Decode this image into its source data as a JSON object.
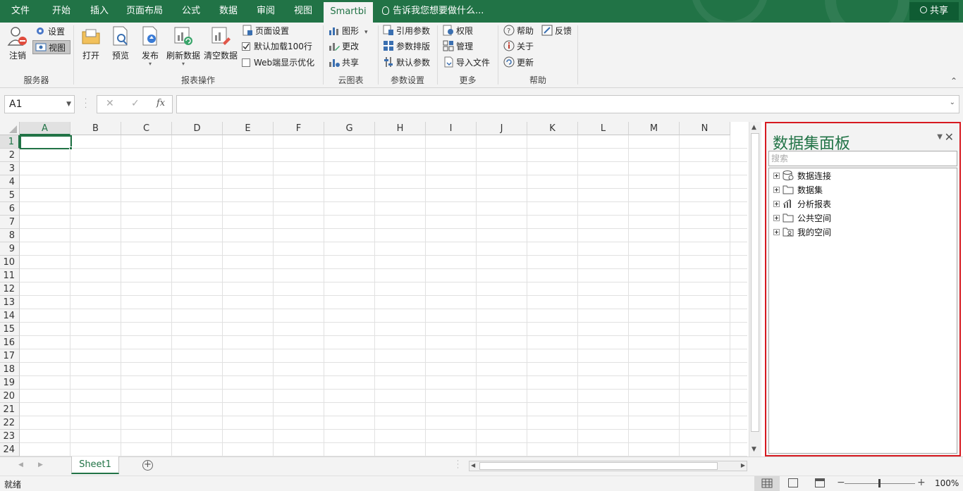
{
  "menu": {
    "tabs": [
      "文件",
      "开始",
      "插入",
      "页面布局",
      "公式",
      "数据",
      "审阅",
      "视图",
      "Smartbi"
    ],
    "tell_me": "告诉我您想要做什么...",
    "share": "共享"
  },
  "ribbon": {
    "server": {
      "logout": "注销",
      "settings": "设置",
      "view": "视图",
      "group_label": "服务器"
    },
    "report_ops": {
      "open": "打开",
      "preview": "预览",
      "publish": "发布",
      "refresh": "刷新数据",
      "clear": "清空数据",
      "page_setup": "页面设置",
      "load_default": "默认加载100行",
      "web_optimize": "Web端显示优化",
      "group_label": "报表操作"
    },
    "cloud_chart": {
      "chart": "图形",
      "change": "更改",
      "share": "共享",
      "group_label": "云图表"
    },
    "params": {
      "ref_param": "引用参数",
      "param_layout": "参数排版",
      "default_param": "默认参数",
      "group_label": "参数设置"
    },
    "more": {
      "permission": "权限",
      "manage": "管理",
      "import_file": "导入文件",
      "group_label": "更多"
    },
    "help": {
      "help": "帮助",
      "feedback": "反馈",
      "about": "关于",
      "update": "更新",
      "group_label": "帮助"
    }
  },
  "formula_bar": {
    "name_box": "A1",
    "fx": "fx",
    "cancel": "✕",
    "enter": "✓"
  },
  "grid": {
    "columns": [
      "A",
      "B",
      "C",
      "D",
      "E",
      "F",
      "G",
      "H",
      "I",
      "J",
      "K",
      "L",
      "M",
      "N"
    ],
    "rows": [
      "1",
      "2",
      "3",
      "4",
      "5",
      "6",
      "7",
      "8",
      "9",
      "10",
      "11",
      "12",
      "13",
      "14",
      "15",
      "16",
      "17",
      "18",
      "19",
      "20",
      "21",
      "22",
      "23",
      "24"
    ]
  },
  "panel": {
    "title": "数据集面板",
    "search_placeholder": "搜索",
    "nodes": [
      "数据连接",
      "数据集",
      "分析报表",
      "公共空间",
      "我的空间"
    ]
  },
  "sheets": {
    "tabs": [
      "Sheet1"
    ]
  },
  "status": {
    "ready": "就绪",
    "zoom": "100%"
  },
  "colors": {
    "accent": "#217346",
    "highlight_border": "#d71920"
  }
}
